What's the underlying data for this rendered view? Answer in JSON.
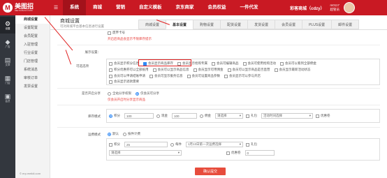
{
  "header": {
    "logo_text": "美图招",
    "logo_sub": "MEITUZHAO.COM",
    "menu_toggle": "☰",
    "nav": [
      "系统",
      "商城",
      "营销",
      "自定义模板",
      "京东商家",
      "会员权益",
      "一件代发"
    ],
    "user_name": "彩客商城（cdzy）",
    "user_id": "m0117",
    "user_role": "超管员"
  },
  "sidebar": {
    "items": [
      {
        "icon": "gear-icon",
        "label": "设置",
        "glyph": "⚙"
      },
      {
        "icon": "diamond-icon",
        "label": "广告",
        "glyph": "◆"
      },
      {
        "icon": "document-icon",
        "label": "文章",
        "glyph": "▤"
      },
      {
        "icon": "store-icon",
        "label": "门店",
        "glyph": "▦"
      },
      {
        "icon": "lock-icon",
        "label": "会员",
        "glyph": "▣"
      }
    ]
  },
  "subnav": {
    "items": [
      "商城设置",
      "设置配置",
      "会员配置",
      "入驻管理",
      "行业设置",
      "门店管理",
      "系统消息",
      "审核订单",
      "发票设置"
    ],
    "footer": "© erp.meiidi.com"
  },
  "page": {
    "title": "商城设置",
    "desc": "可对商城平台基本信息进行设置",
    "tabs": [
      "商城设置",
      "基本设置",
      "购物设置",
      "配货设置",
      "发货设置",
      "会员设置",
      "PLUS设置",
      "邮件设置"
    ],
    "top_option": "废弃卡号",
    "top_warn": "开启后商品会显示不限库存提示",
    "section_label": "展示设置：",
    "field_label": "可选选项",
    "checkbox_rows": [
      [
        "会员显示积分信息",
        "会员显示商品库存",
        "会员显示抢购专属",
        "会员可编辑商品",
        "会员可使用抢购活动",
        "会员可以看到全部佣金",
        "积分优惠券可以全部抵用"
      ],
      [
        "会员可以显示商品信息",
        "会员显示可用佣金",
        "会员可以显示商品是否直营",
        "会员显示最新活动状态",
        "会员可以申请结账申请"
      ],
      [
        "会员可显示服务信息",
        "会员可设置商品参数",
        "会员显示可以参与开店",
        "会员显示退款需要"
      ]
    ],
    "highlighted_option": "会员显示商品库存",
    "share_label": "是否开启分享",
    "share_options": [
      "全站分享权限",
      "仅会员可分享"
    ],
    "share_warn": "仅会员开启时分享显示商品",
    "stock_label": "库存模式",
    "stock_row": {
      "opt1": "积分",
      "val1": "100",
      "opt2": "现金",
      "val2": "100",
      "opt3": "佣金",
      "select": "请选择",
      "opt4": "礼包",
      "select2": "活动时间选择",
      "opt5": "优惠卷"
    },
    "ship_label": "运费模式",
    "ship_row1": {
      "opt1": "默认",
      "opt2": "按件计费"
    },
    "ship_row2": {
      "opt1": "积分",
      "val1": "25",
      "opt2": "每件",
      "select": "1月13日第一次运费选择",
      "opt3": "礼包"
    },
    "ship_row3": {
      "select": "请选择",
      "opt1": "优惠卷",
      "val": "0"
    },
    "submit": "确认提交"
  },
  "colors": {
    "brand": "#c91923",
    "accent": "#2f89f5",
    "warn": "#e8423e",
    "annotation": "#e02020"
  }
}
